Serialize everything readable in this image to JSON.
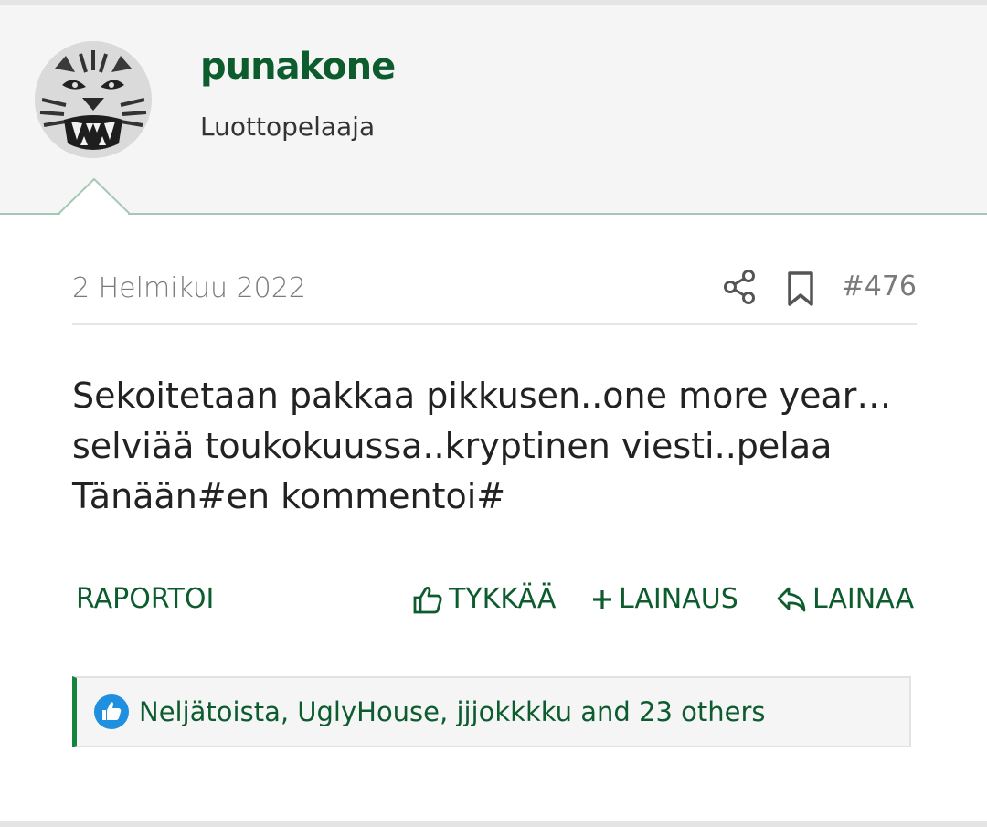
{
  "user": {
    "name": "punakone",
    "title": "Luottopelaaja",
    "avatar_icon": "tiger-face-avatar"
  },
  "post": {
    "date": "2 Helmikuu 2022",
    "number": "#476",
    "body": "Sekoitetaan pakkaa pikkusen..one more year…\nselviää toukokuussa..kryptinen viesti..pelaa\nTänään#en kommentoi#"
  },
  "actions": {
    "report": "RAPORTOI",
    "like": "TYKKÄÄ",
    "multiquote": "LAINAUS",
    "quote": "LAINAA"
  },
  "reactions": {
    "text": "Neljätoista, UglyHouse, jjjokkkku and 23 others",
    "icon": "thumbs-up-badge-icon"
  },
  "colors": {
    "accent_green": "#0d5c2e",
    "reaction_bar": "#14853b",
    "reaction_badge": "#1f8fe0"
  }
}
